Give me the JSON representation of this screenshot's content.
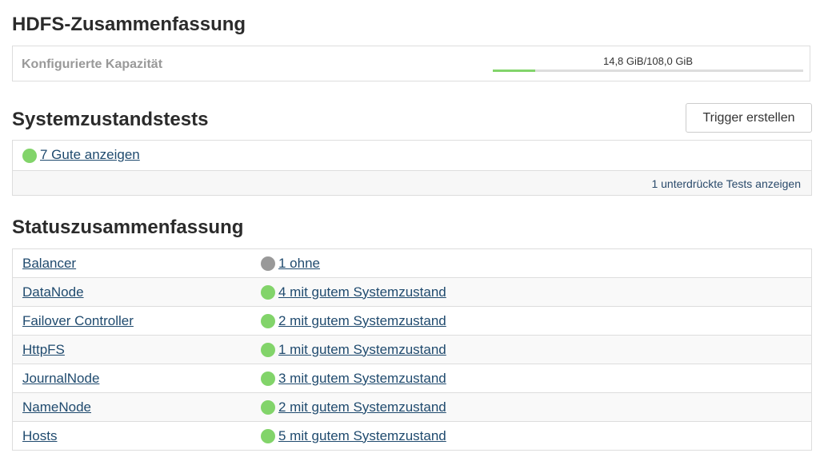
{
  "hdfs_summary": {
    "title": "HDFS-Zusammenfassung",
    "capacity_label": "Konfigurierte Kapazität",
    "capacity_value": "14,8 GiB/108,0 GiB",
    "capacity_fraction": 0.137
  },
  "health_tests": {
    "title": "Systemzustandstests",
    "trigger_button": "Trigger erstellen",
    "good_link": "7 Gute anzeigen",
    "good_status_color": "#82d46a",
    "suppressed_link": "1 unterdrückte Tests anzeigen"
  },
  "status_summary": {
    "title": "Statuszusammenfassung",
    "rows": [
      {
        "name": "Balancer",
        "state": "1 ohne",
        "status": "none"
      },
      {
        "name": "DataNode",
        "state": "4 mit gutem Systemzustand",
        "status": "good"
      },
      {
        "name": "Failover Controller",
        "state": "2 mit gutem Systemzustand",
        "status": "good"
      },
      {
        "name": "HttpFS",
        "state": "1 mit gutem Systemzustand",
        "status": "good"
      },
      {
        "name": "JournalNode",
        "state": "3 mit gutem Systemzustand",
        "status": "good"
      },
      {
        "name": "NameNode",
        "state": "2 mit gutem Systemzustand",
        "status": "good"
      },
      {
        "name": "Hosts",
        "state": "5 mit gutem Systemzustand",
        "status": "good"
      }
    ]
  },
  "colors": {
    "good": "#82d46a",
    "none": "#999999",
    "link": "#1f4a6e"
  }
}
